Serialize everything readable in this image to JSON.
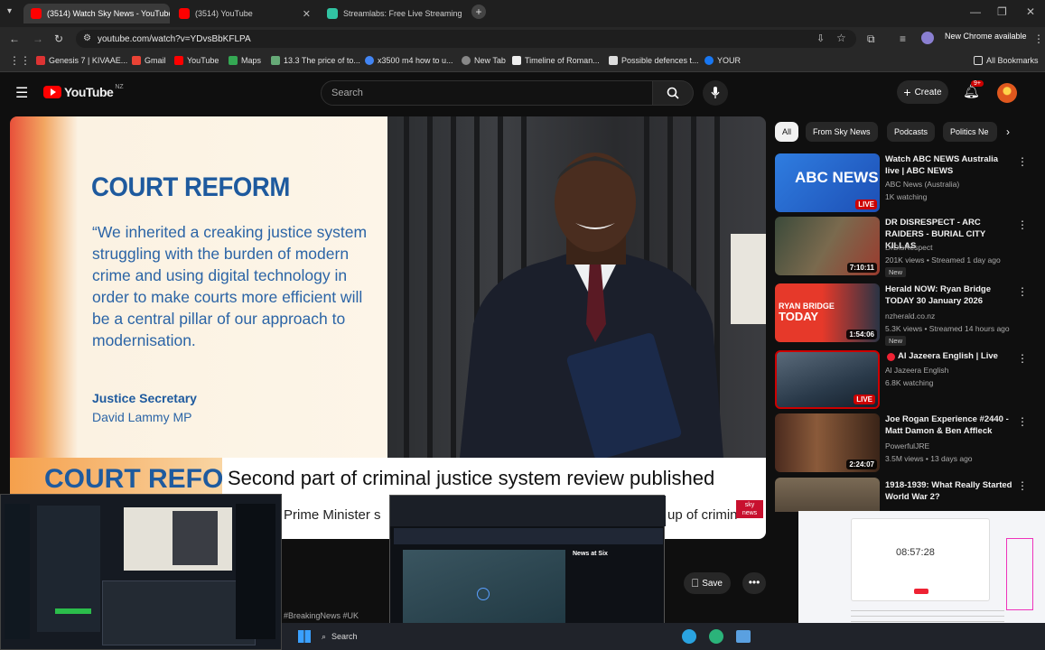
{
  "browser": {
    "tabs": [
      {
        "title": "(3514) Watch Sky News - YouTube",
        "active": true
      },
      {
        "title": "(3514) YouTube",
        "active": false
      },
      {
        "title": "Streamlabs: Free Live Streaming",
        "active": false
      }
    ],
    "url": "youtube.com/watch?v=YDvsBbKFLPA",
    "new_chrome_label": "New Chrome available",
    "bookmarks": [
      "Genesis 7 | KIVAAE...",
      "Gmail",
      "YouTube",
      "Maps",
      "13.3 The price of to...",
      "x3500 m4 how to u...",
      "New Tab",
      "Timeline of Roman...",
      "Possible defences t...",
      "YOUR"
    ],
    "all_bookmarks_label": "All Bookmarks",
    "colors": {
      "accent": "#ff0000",
      "bg": "#0f0f0f"
    }
  },
  "youtube": {
    "logo_text": "YouTube",
    "region": "NZ",
    "search_placeholder": "Search",
    "create_label": "Create",
    "notif_count": "9+",
    "chips": [
      "All",
      "From Sky News",
      "Podcasts",
      "Politics Ne"
    ],
    "save_label": "Save",
    "hashtags": "#BreakingNews #UK"
  },
  "video": {
    "graphic_title": "COURT REFORM",
    "quote": "“We inherited a creaking justice system struggling with the burden of modern crime and using digital technology in order to make courts more efficient will be a central pillar of our approach to modernisation.",
    "speaker_role": "Justice Secretary",
    "speaker_name": "David Lammy MP",
    "lower_tag": "COURT REFORM",
    "headline": "Second part of criminal justice system review published",
    "ticker_left": "Prime Minister s",
    "ticker_right": "up of crimin",
    "sky_logo": "sky news"
  },
  "recommendations": [
    {
      "title": "Watch ABC NEWS Australia live | ABC NEWS",
      "channel": "ABC News (Australia)",
      "meta": "1K watching",
      "badge": "LIVE",
      "duration": "",
      "new": false
    },
    {
      "title": "DR DISRESPECT - ARC RAIDERS - BURIAL CITY KILLAS",
      "channel": "DrDisRespect",
      "meta": "201K views • Streamed 1 day ago",
      "badge": "",
      "duration": "7:10:11",
      "new": true
    },
    {
      "title": "Herald NOW: Ryan Bridge TODAY 30 January 2026",
      "channel": "nzherald.co.nz",
      "meta": "5.3K views • Streamed 14 hours ago",
      "badge": "",
      "duration": "1:54:06",
      "new": true
    },
    {
      "title": "Al Jazeera English | Live",
      "channel": "Al Jazeera English",
      "meta": "6.8K watching",
      "badge": "LIVE",
      "duration": "",
      "new": false
    },
    {
      "title": "Joe Rogan Experience #2440 - Matt Damon & Ben Affleck",
      "channel": "PowerfulJRE",
      "meta": "3.5M views • 13 days ago",
      "badge": "",
      "duration": "2:24:07",
      "new": false
    },
    {
      "title": "1918-1939: What Really Started World War 2?",
      "channel": "",
      "meta": "",
      "badge": "",
      "duration": "",
      "new": false
    }
  ],
  "overlays": {
    "mid_title": "News at Six",
    "clock": "08:57:28",
    "taskbar_search": "Search"
  }
}
